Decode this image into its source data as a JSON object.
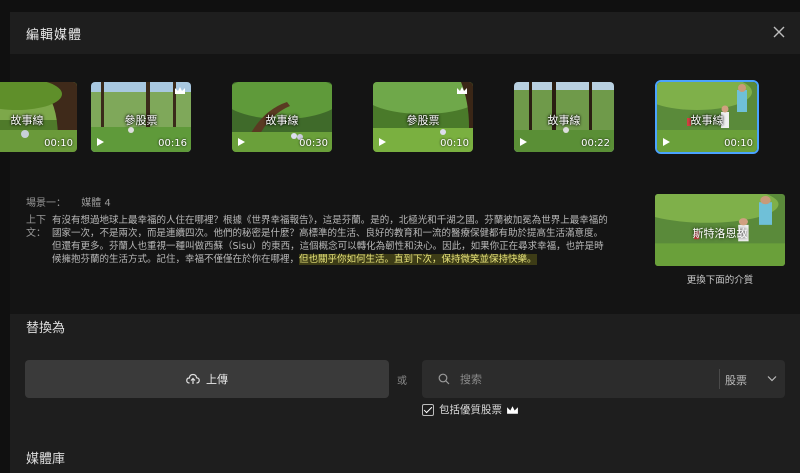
{
  "modal": {
    "title": "編輯媒體"
  },
  "thumbnails": [
    {
      "label": "故事線",
      "duration": "00:10",
      "premium": false,
      "selected": false
    },
    {
      "label": "參股票",
      "duration": "00:16",
      "premium": true,
      "selected": false
    },
    {
      "label": "故事線",
      "duration": "00:30",
      "premium": false,
      "selected": false
    },
    {
      "label": "參股票",
      "duration": "00:10",
      "premium": true,
      "selected": false
    },
    {
      "label": "故事線",
      "duration": "00:22",
      "premium": false,
      "selected": false
    },
    {
      "label": "故事線",
      "duration": "00:10",
      "premium": false,
      "selected": true
    }
  ],
  "scene": {
    "label": "場景一：",
    "media": "媒體 4"
  },
  "context": {
    "label": "上下文：",
    "text": "有沒有想過地球上最幸福的人住在哪裡？根據《世界幸福報告》，這是芬蘭。是的，北極光和千湖之國。芬蘭被加冕為世界上最幸福的國家一次，不是兩次，而是連續四次。他們的秘密是什麼？高標準的生活、良好的教育和一流的醫療保健都有助於提高生活滿意度。但還有更多。芬蘭人也重視一種叫做西蘇（Sisu）的東西，這個概念可以轉化為韌性和決心。因此，如果你正在尋求幸福，也許是時候擁抱芬蘭的生活方式。記住，幸福不僅僅在於你在哪裡，",
    "highlight": "但也關乎你如何生活。直到下次，保持微笑並保持快樂。"
  },
  "preview": {
    "label": "斯特洛恩故",
    "caption": "更換下面的介質"
  },
  "replace": {
    "title": "替換為",
    "upload_label": "上傳",
    "or": "或",
    "search_placeholder": "搜索",
    "category": "股票",
    "checkbox_label": "包括優質股票"
  },
  "library": {
    "title": "媒體庫"
  },
  "colors": {
    "accent": "#4aa3ff",
    "crown": "#ffffff",
    "highlight_bg": "#3d3c16",
    "highlight_text": "#e6e27a"
  }
}
